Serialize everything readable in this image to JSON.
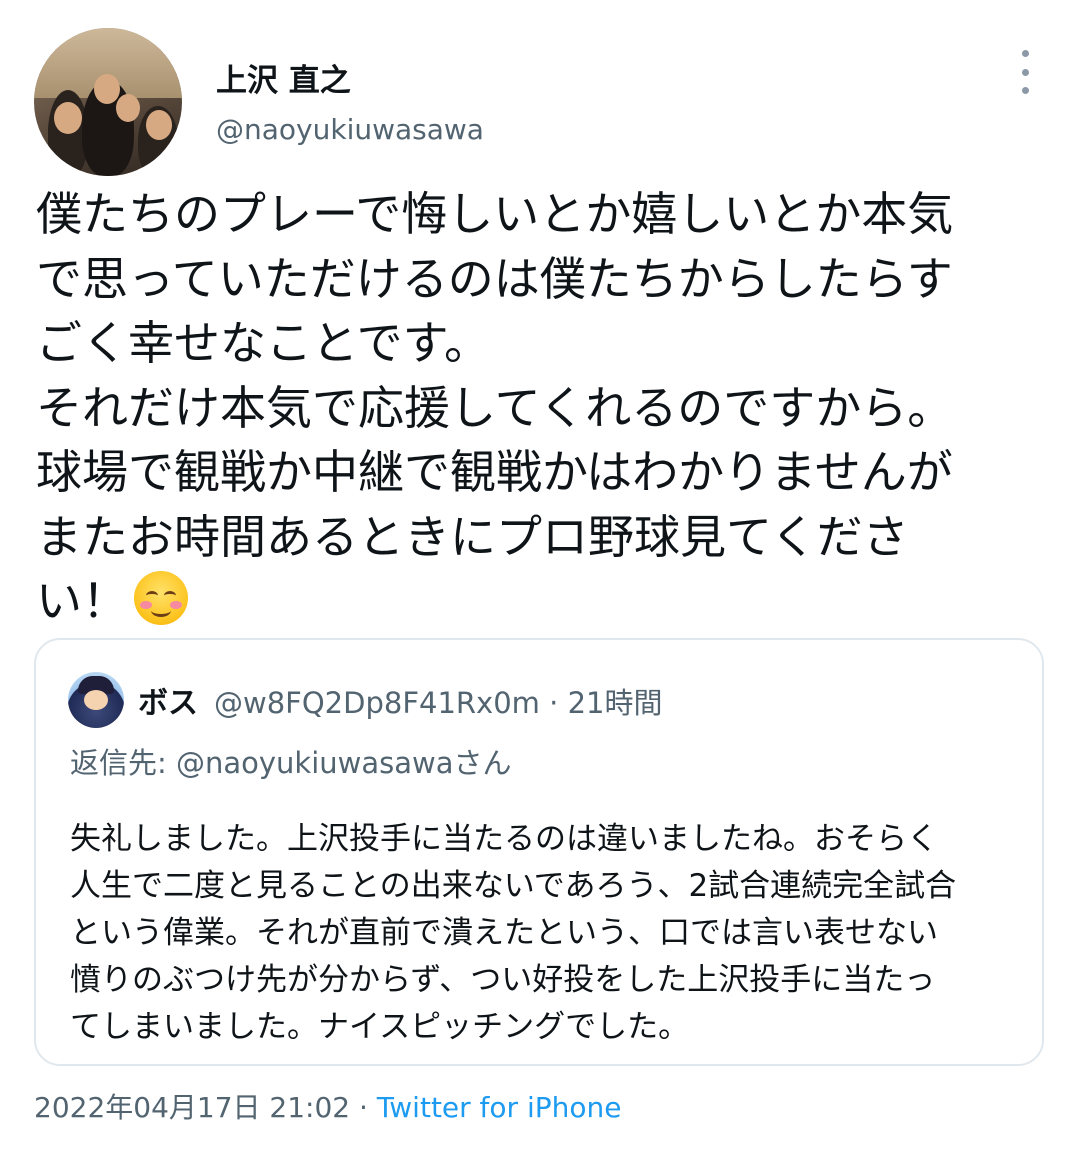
{
  "author": {
    "display_name": "上沢 直之",
    "handle": "@naoyukiuwasawa"
  },
  "tweet": {
    "text": "僕たちのプレーで悔しいとか嬉しいとか本気\nで思っていただけるのは僕たちからしたらす\nごく幸せなことです。\nそれだけ本気で応援してくれるのですから。\n球場で観戦か中継で観戦かはわかりませんが\nまたお時間あるときにプロ野球見てくださ\nい！",
    "emoji": "smiling-face-with-smiling-eyes"
  },
  "quoted": {
    "display_name": "ボス",
    "handle_time": "@w8FQ2Dp8F41Rx0m · 21時間",
    "reply_to": "返信先: @naoyukiuwasawaさん",
    "text": "失礼しました。上沢投手に当たるのは違いましたね。おそらく\n人生で二度と見ることの出来ないであろう、2試合連続完全試合\nという偉業。それが直前で潰えたという、口では言い表せない\n憤りのぶつけ先が分からず、つい好投をした上沢投手に当たっ\nてしまいました。ナイスピッチングでした。"
  },
  "meta": {
    "timestamp": "2022年04月17日 21:02",
    "separator": " · ",
    "source": "Twitter for iPhone"
  },
  "icons": {
    "more": "more-vertical-icon"
  },
  "colors": {
    "text": "#0f1419",
    "secondary": "#536471",
    "link": "#1d9bf0",
    "border": "#e1e8ed"
  }
}
